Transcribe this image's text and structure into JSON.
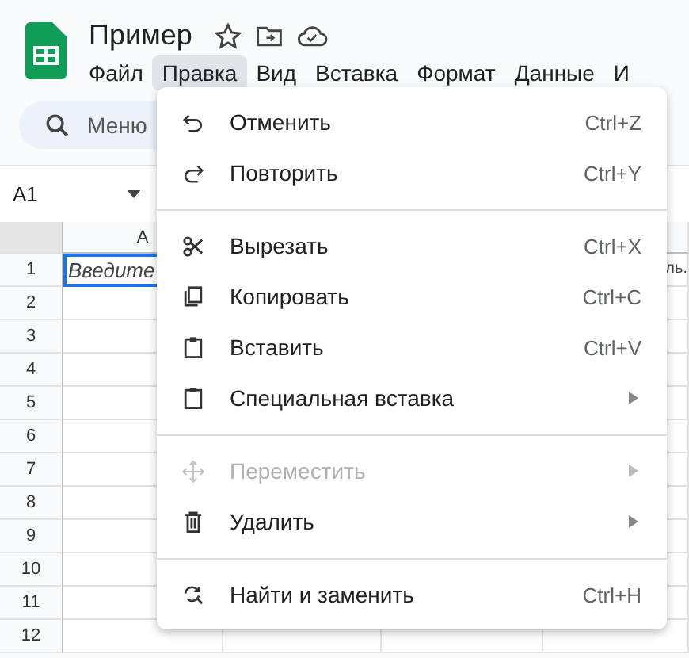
{
  "document": {
    "title": "Пример"
  },
  "menu_bar": [
    {
      "label": "Файл",
      "selected": false
    },
    {
      "label": "Правка",
      "selected": true
    },
    {
      "label": "Вид",
      "selected": false
    },
    {
      "label": "Вставка",
      "selected": false
    },
    {
      "label": "Формат",
      "selected": false
    },
    {
      "label": "Данные",
      "selected": false
    },
    {
      "label": "И",
      "selected": false
    }
  ],
  "search": {
    "placeholder": "Меню"
  },
  "name_box": {
    "value": "A1"
  },
  "grid": {
    "columns": [
      "A"
    ],
    "rows": [
      "1",
      "2",
      "3",
      "4",
      "5",
      "6",
      "7",
      "8",
      "9",
      "10",
      "11",
      "12"
    ],
    "cell_a1": "Введите",
    "cell_row1_right": "ль."
  },
  "edit_menu": {
    "groups": [
      [
        {
          "label": "Отменить",
          "shortcut": "Ctrl+Z",
          "submenu": false,
          "disabled": false
        },
        {
          "label": "Повторить",
          "shortcut": "Ctrl+Y",
          "submenu": false,
          "disabled": false
        }
      ],
      [
        {
          "label": "Вырезать",
          "shortcut": "Ctrl+X",
          "submenu": false,
          "disabled": false
        },
        {
          "label": "Копировать",
          "shortcut": "Ctrl+C",
          "submenu": false,
          "disabled": false
        },
        {
          "label": "Вставить",
          "shortcut": "Ctrl+V",
          "submenu": false,
          "disabled": false
        },
        {
          "label": "Специальная вставка",
          "submenu": true,
          "disabled": false
        }
      ],
      [
        {
          "label": "Переместить",
          "submenu": true,
          "disabled": true
        },
        {
          "label": "Удалить",
          "submenu": true,
          "disabled": false
        }
      ],
      [
        {
          "label": "Найти и заменить",
          "shortcut": "Ctrl+H",
          "submenu": false,
          "disabled": false
        }
      ]
    ]
  }
}
